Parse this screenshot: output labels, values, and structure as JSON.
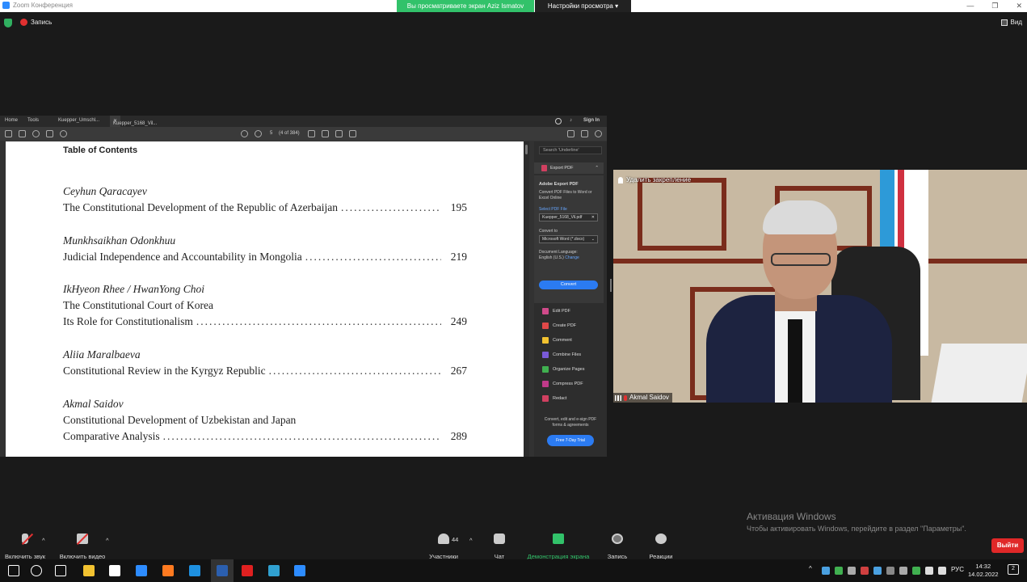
{
  "window": {
    "title": "Zoom Конференция",
    "share_banner": "Вы просматриваете экран Aziz Ismatov",
    "view_options": "Настройки просмотра"
  },
  "top_bar": {
    "record_label": "Запись",
    "view_label": "Вид"
  },
  "acrobat": {
    "tabs": [
      "Home",
      "Tools",
      "Kuepper_Umschl...",
      "Kuepper_5168_Vil..."
    ],
    "sign_in": "Sign In",
    "page_indicator": "(4 of 384)",
    "search_placeholder": "Search 'Underline'",
    "export_header": "Export PDF",
    "panel": {
      "title": "Adobe Export PDF",
      "desc": "Convert PDF Files to Word or Excel Online",
      "select_label": "Select PDF File",
      "file_value": "Kuepper_5168_Vil.pdf",
      "convert_to_label": "Convert to",
      "convert_to_value": "Microsoft Word (*.docx)",
      "doc_lang_label": "Document Language:",
      "doc_lang_value": "English (U.S.)",
      "change_link": "Change",
      "convert_button": "Convert"
    },
    "tools": [
      {
        "label": "Edit PDF",
        "color": "#d04a8a"
      },
      {
        "label": "Create PDF",
        "color": "#e04848"
      },
      {
        "label": "Comment",
        "color": "#f2c230"
      },
      {
        "label": "Combine Files",
        "color": "#7a5ad8"
      },
      {
        "label": "Organize Pages",
        "color": "#40b050"
      },
      {
        "label": "Compress PDF",
        "color": "#c03a8a"
      },
      {
        "label": "Redact",
        "color": "#d04060"
      }
    ],
    "promo_text": "Convert, edit and e-sign PDF forms & agreements",
    "trial_button": "Free 7-Day Trial"
  },
  "document": {
    "title": "Table of Contents",
    "entries": [
      {
        "author": "Ceyhun Qaracayev",
        "lines": [
          {
            "text": "The Constitutional Development of the Republic of Azerbaijan",
            "page": "195"
          }
        ]
      },
      {
        "author": "Munkhsaikhan Odonkhuu",
        "lines": [
          {
            "text": "Judicial Independence and Accountability in Mongolia",
            "page": "219"
          }
        ]
      },
      {
        "author": "IkHyeon Rhee / HwanYong Choi",
        "lines": [
          {
            "text": "The Constitutional Court of Korea",
            "page": ""
          },
          {
            "text": "Its Role for Constitutionalism",
            "page": "249"
          }
        ]
      },
      {
        "author": "Aliia Maralbaeva",
        "lines": [
          {
            "text": "Constitutional Review in the Kyrgyz Republic",
            "page": "267"
          }
        ]
      },
      {
        "author": "Akmal Saidov",
        "lines": [
          {
            "text": "Constitutional Development of Uzbekistan and Japan",
            "page": ""
          },
          {
            "text": "Comparative Analysis",
            "page": "289"
          }
        ]
      }
    ]
  },
  "video": {
    "unpin_label": "Удалить закрепление",
    "participant_name": "Akmal Saidov"
  },
  "activation": {
    "title": "Активация Windows",
    "subtitle": "Чтобы активировать Windows, перейдите в раздел \"Параметры\"."
  },
  "controls": {
    "mute": "Включить звук",
    "video": "Включить видео",
    "participants": "Участники",
    "participant_count": "44",
    "chat": "Чат",
    "share": "Демонстрация экрана",
    "record": "Запись",
    "reactions": "Реакции",
    "leave": "Выйти"
  },
  "taskbar": {
    "language": "РУС",
    "time": "14:32",
    "date": "14.02.2022",
    "notifications": "2",
    "app_icons": [
      {
        "name": "start-icon",
        "color": "#ffffff"
      },
      {
        "name": "search-icon",
        "color": "#ffffff"
      },
      {
        "name": "task-view-icon",
        "color": "#ffffff"
      },
      {
        "name": "file-explorer-icon",
        "color": "#f2c230"
      },
      {
        "name": "store-icon",
        "color": "#ffffff"
      },
      {
        "name": "mail-icon",
        "color": "#2d8cff"
      },
      {
        "name": "firefox-icon",
        "color": "#ff7a20"
      },
      {
        "name": "edge-icon",
        "color": "#1e90e0"
      },
      {
        "name": "word-icon",
        "color": "#2b5faf"
      },
      {
        "name": "yandex-icon",
        "color": "#e02020"
      },
      {
        "name": "chrome-icon",
        "color": "#30a0d0"
      },
      {
        "name": "zoom-icon",
        "color": "#2d8cff"
      }
    ]
  }
}
